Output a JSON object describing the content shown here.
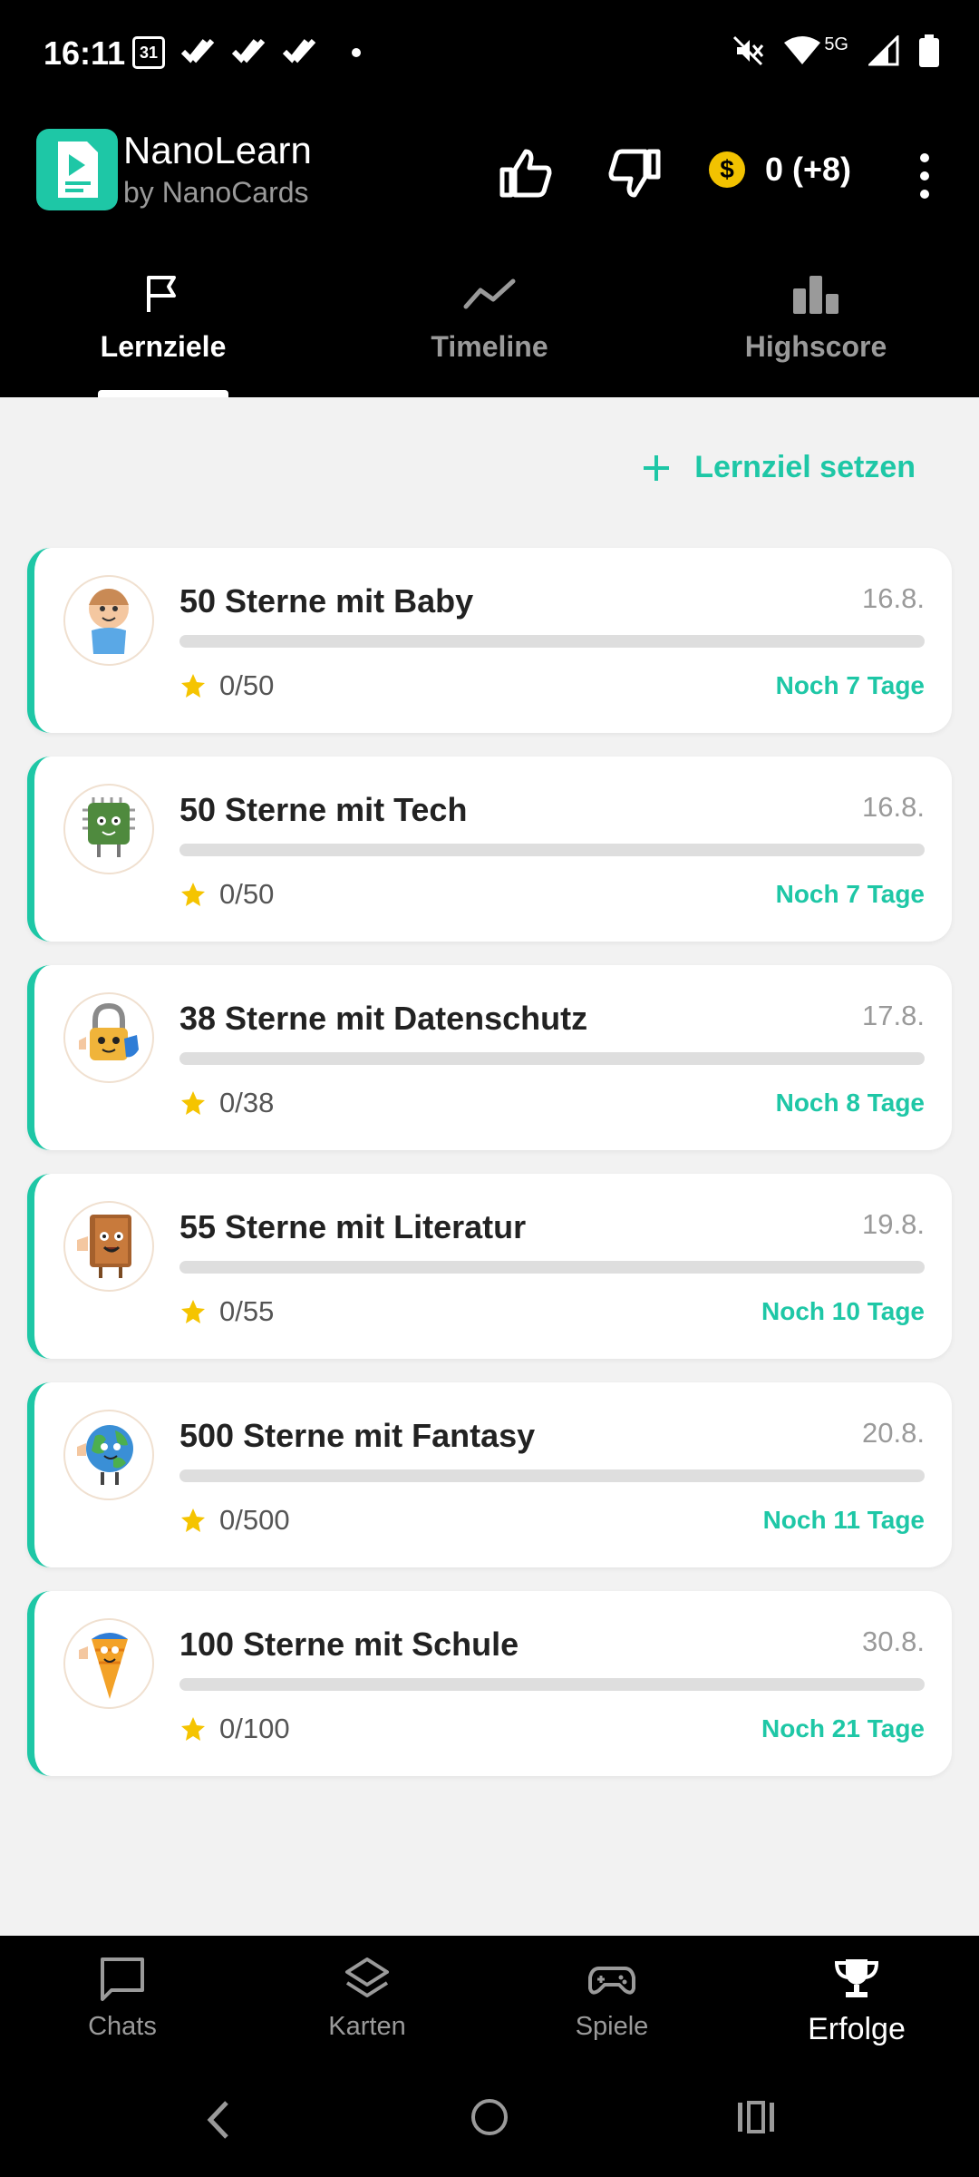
{
  "status": {
    "time": "16:11",
    "calendar_day": "31",
    "network": "5G"
  },
  "app": {
    "title": "NanoLearn",
    "subtitle": "by NanoCards"
  },
  "header": {
    "coins": "0 (+8)",
    "coin_symbol": "$"
  },
  "tabs": [
    {
      "label": "Lernziele",
      "icon": "flag-icon",
      "active": true
    },
    {
      "label": "Timeline",
      "icon": "trend-line-icon",
      "active": false
    },
    {
      "label": "Highscore",
      "icon": "bar-chart-icon",
      "active": false
    }
  ],
  "actions": {
    "add_goal": "Lernziel setzen"
  },
  "goals": [
    {
      "title": "50 Sterne mit Baby",
      "date": "16.8.",
      "stars": "0/50",
      "remaining": "Noch 7 Tage",
      "progress": 0,
      "avatar": "baby-avatar-icon"
    },
    {
      "title": "50 Sterne mit Tech",
      "date": "16.8.",
      "stars": "0/50",
      "remaining": "Noch 7 Tage",
      "progress": 0,
      "avatar": "chip-avatar-icon"
    },
    {
      "title": "38 Sterne mit Datenschutz",
      "date": "17.8.",
      "stars": "0/38",
      "remaining": "Noch 8 Tage",
      "progress": 0,
      "avatar": "padlock-avatar-icon"
    },
    {
      "title": "55 Sterne mit Literatur",
      "date": "19.8.",
      "stars": "0/55",
      "remaining": "Noch 10 Tage",
      "progress": 0,
      "avatar": "book-avatar-icon"
    },
    {
      "title": "500 Sterne mit Fantasy",
      "date": "20.8.",
      "stars": "0/500",
      "remaining": "Noch 11 Tage",
      "progress": 0,
      "avatar": "globe-avatar-icon"
    },
    {
      "title": "100 Sterne mit Schule",
      "date": "30.8.",
      "stars": "0/100",
      "remaining": "Noch 21 Tage",
      "progress": 0,
      "avatar": "school-cone-avatar-icon"
    }
  ],
  "bottom_nav": [
    {
      "label": "Chats",
      "icon": "chat-icon",
      "active": false
    },
    {
      "label": "Karten",
      "icon": "layers-icon",
      "active": false
    },
    {
      "label": "Spiele",
      "icon": "gamepad-icon",
      "active": false
    },
    {
      "label": "Erfolge",
      "icon": "trophy-icon",
      "active": true
    }
  ],
  "colors": {
    "accent": "#1ec7a6",
    "coin": "#f2c200",
    "star": "#f5c400",
    "background": "#f2f2f2"
  }
}
